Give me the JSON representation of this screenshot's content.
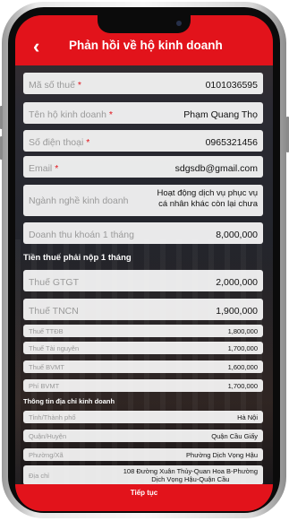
{
  "header": {
    "title": "Phản hồi về hộ kinh doanh"
  },
  "fields": {
    "tax_code": {
      "label": "Mã số thuế",
      "value": "0101036595"
    },
    "business_name": {
      "label": "Tên hộ kinh doanh",
      "value": "Phạm Quang Thọ"
    },
    "phone": {
      "label": "Số điện thoại",
      "value": "0965321456"
    },
    "email": {
      "label": "Email",
      "value": "sdgsdb@gmail.com"
    },
    "industry": {
      "label": "Ngành nghề kinh doanh",
      "value_line1": "Hoạt động dịch vụ phục vụ",
      "value_line2": "cá nhân khác còn lại chưa"
    },
    "revenue": {
      "label": "Doanh thu khoán 1 tháng",
      "value": "8,000,000"
    }
  },
  "required_mark": "*",
  "tax_section": {
    "title": "Tiền thuế phải nộp 1 tháng",
    "gtgt": {
      "label": "Thuế GTGT",
      "value": "2,000,000"
    },
    "tncn": {
      "label": "Thuế TNCN",
      "value": "1,900,000"
    },
    "ttdb": {
      "label": "Thuế TTĐB",
      "value": "1,800,000"
    },
    "resource": {
      "label": "Thuế Tài nguyên",
      "value": "1,700,000"
    },
    "bvmt": {
      "label": "Thuế BVMT",
      "value": "1,600,000"
    },
    "fee": {
      "label": "Phí BVMT",
      "value": "1,700,000"
    }
  },
  "address_section": {
    "title": "Thông tin địa chỉ kinh doanh",
    "province": {
      "label": "Tỉnh/Thành phố",
      "value": "Hà Nội"
    },
    "district": {
      "label": "Quận/Huyện",
      "value": "Quận Cầu Giấy"
    },
    "ward": {
      "label": "Phường/Xã",
      "value": "Phường Dịch Vọng Hậu"
    },
    "address": {
      "label": "Địa chỉ",
      "value_line1": "108 Đường Xuân Thủy-Quan Hoa B-Phường",
      "value_line2": "Dịch Vọng Hậu-Quận Cầu"
    }
  },
  "footer": {
    "button_label": "Tiếp tục"
  },
  "colors": {
    "accent": "#e2131b",
    "field_bg": "#ffffff",
    "label": "#9a9a9a"
  }
}
